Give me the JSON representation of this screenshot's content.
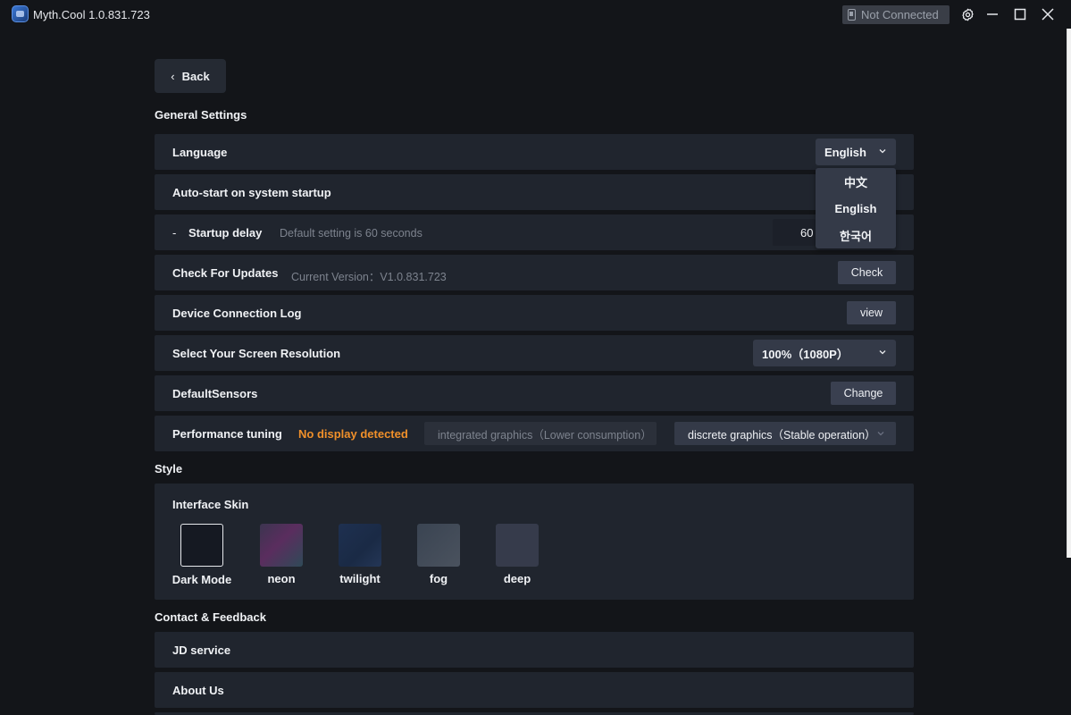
{
  "titlebar": {
    "app_title": "Myth.Cool  1.0.831.723",
    "connection_status": "Not Connected"
  },
  "back_label": "Back",
  "sections": {
    "general": "General Settings",
    "style": "Style",
    "contact": "Contact & Feedback"
  },
  "language": {
    "label": "Language",
    "selected": "English",
    "options": [
      "中文",
      "English",
      "한국어"
    ]
  },
  "autostart": {
    "label": "Auto-start on system startup"
  },
  "startup_delay": {
    "dash": "-",
    "label": "Startup delay",
    "hint": "Default setting is 60 seconds",
    "value": "60"
  },
  "updates": {
    "label": "Check For Updates",
    "hint": "Current Version：V1.0.831.723",
    "button": "Check"
  },
  "connection_log": {
    "label": "Device Connection Log",
    "button": "view"
  },
  "resolution": {
    "label": "Select Your Screen Resolution",
    "selected": "100%（1080P）"
  },
  "default_sensors": {
    "label": "DefaultSensors",
    "button": "Change"
  },
  "performance": {
    "label": "Performance tuning",
    "warning": "No display detected",
    "option_integrated": "integrated graphics（Lower consumption）",
    "option_discrete": "discrete graphics（Stable operation）"
  },
  "interface_skin": {
    "label": "Interface Skin",
    "skins": [
      {
        "name": "Dark Mode",
        "selected": true
      },
      {
        "name": "neon"
      },
      {
        "name": "twilight"
      },
      {
        "name": "fog"
      },
      {
        "name": "deep"
      }
    ]
  },
  "contact": {
    "jd_service": "JD service",
    "about_us": "About Us"
  },
  "colors": {
    "background": "#131519",
    "row": "#20252e",
    "control": "#343a48",
    "warning": "#f0902a"
  }
}
